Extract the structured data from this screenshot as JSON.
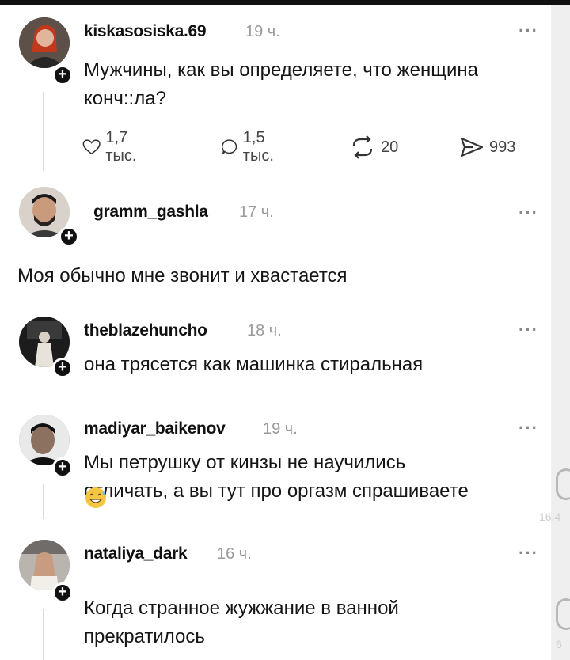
{
  "posts": [
    {
      "username": "kiskasosiska.69",
      "time": "19 ч.",
      "text_line1": "Мужчины, как вы определяете, что женщина",
      "text_line2": "конч::ла?",
      "likes": "1,7 тыс.",
      "replies": "1,5 тыс.",
      "reposts": "20",
      "shares": "993"
    },
    {
      "username": "gramm_gashla",
      "time": "17 ч.",
      "text_line1": "Моя обычно мне звонит и хвастается"
    },
    {
      "username": "theblazehuncho",
      "time": "18 ч.",
      "text_line1": "она трясется как машинка стиральная"
    },
    {
      "username": "madiyar_baikenov",
      "time": "19 ч.",
      "text_line1": "Мы петрушку от кинзы не научились",
      "text_line2": "отличать, а вы тут про оргазм спрашиваете"
    },
    {
      "username": "nataliya_dark",
      "time": "16 ч.",
      "text_line1": "Когда странное жужжание в ванной",
      "text_line2": "прекратилось"
    }
  ],
  "more_label": "···",
  "plus_label": "+",
  "side_partial_1": "16.4",
  "side_partial_2": "6"
}
